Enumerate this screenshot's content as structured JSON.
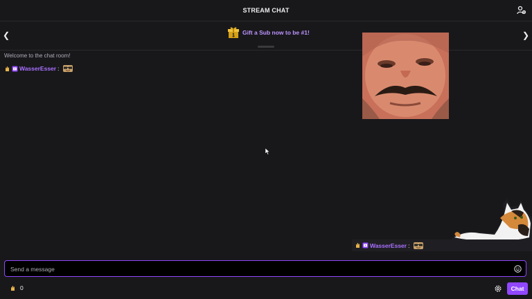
{
  "header": {
    "title": "STREAM CHAT",
    "users_icon": "user-list-icon"
  },
  "banner": {
    "text": "Gift a Sub now to be #1!",
    "gift_icon": "gift-icon",
    "gift_number": "1"
  },
  "chat": {
    "welcome": "Welcome to the chat room!",
    "messages": [
      {
        "username": "WasserEsser",
        "separator": ":",
        "emote": "sunglasses-emote"
      }
    ]
  },
  "overlay_message": {
    "username": "WasserEsser",
    "separator": ":",
    "emote": "sunglasses-emote"
  },
  "input": {
    "placeholder": "Send a message",
    "value": ""
  },
  "footer": {
    "points": "0",
    "chat_button": "Chat",
    "settings_icon": "gear-icon"
  },
  "colors": {
    "accent": "#9147ff",
    "username": "#a970ff",
    "banner_text": "#bf94ff",
    "background": "#18181b"
  }
}
